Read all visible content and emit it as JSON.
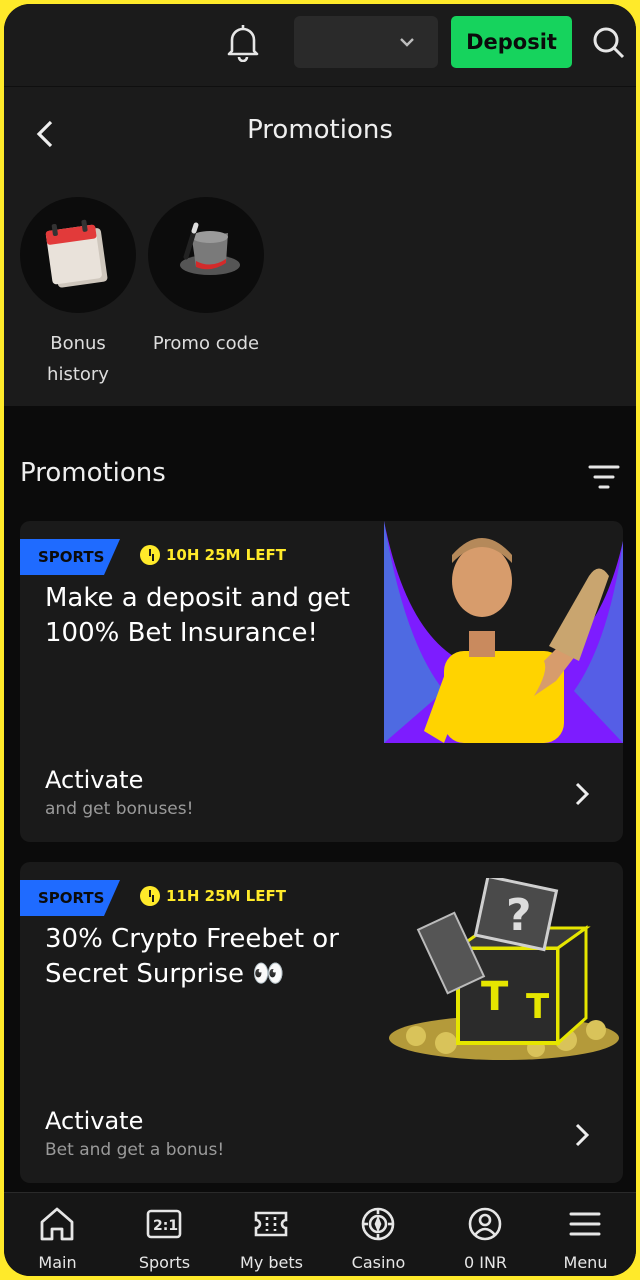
{
  "topbar": {
    "deposit_label": "Deposit",
    "currency_select_value": ""
  },
  "header": {
    "title": "Promotions",
    "shortcuts": [
      {
        "label_line1": "Bonus",
        "label_line2": "history"
      },
      {
        "label_line1": "Promo code",
        "label_line2": ""
      }
    ]
  },
  "promotions": {
    "section_title": "Promotions",
    "cards": [
      {
        "tag": "SPORTS",
        "timer": "10H 25M LEFT",
        "headline": "Make a deposit and get 100% Bet Insurance!",
        "action": "Activate",
        "action_sub": "and get bonuses!"
      },
      {
        "tag": "SPORTS",
        "timer": "11H 25M LEFT",
        "headline": "30% Crypto Freebet or Secret Surprise 👀",
        "action": "Activate",
        "action_sub": "Bet and get a bonus!"
      }
    ]
  },
  "nav": {
    "items": [
      {
        "label": "Main",
        "icon": "home-icon"
      },
      {
        "label": "Sports",
        "icon": "scoreboard-icon"
      },
      {
        "label": "My bets",
        "icon": "ticket-icon"
      },
      {
        "label": "Casino",
        "icon": "casino-chip-icon"
      },
      {
        "label": "0 INR",
        "icon": "account-icon"
      },
      {
        "label": "Menu",
        "icon": "menu-icon"
      }
    ]
  },
  "colors": {
    "accent_green": "#16d35d",
    "tag_blue": "#1f6bff",
    "timer_yellow": "#ffea2a",
    "purple": "#7d1cff"
  }
}
